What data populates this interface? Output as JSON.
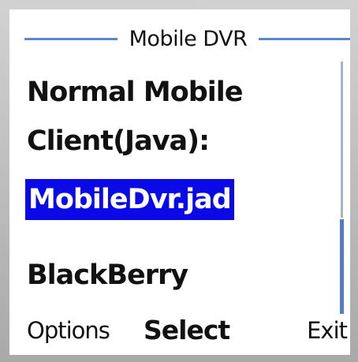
{
  "title": "Mobile DVR",
  "content": {
    "line1": "Normal Mobile",
    "line2": "Client(Java):",
    "link": "MobileDvr.jad",
    "line4": "BlackBerry"
  },
  "softkeys": {
    "left": "Options",
    "center": "Select",
    "right": "Exit"
  },
  "colors": {
    "accent": "#5b86c9",
    "selection": "#0a0ae8"
  }
}
